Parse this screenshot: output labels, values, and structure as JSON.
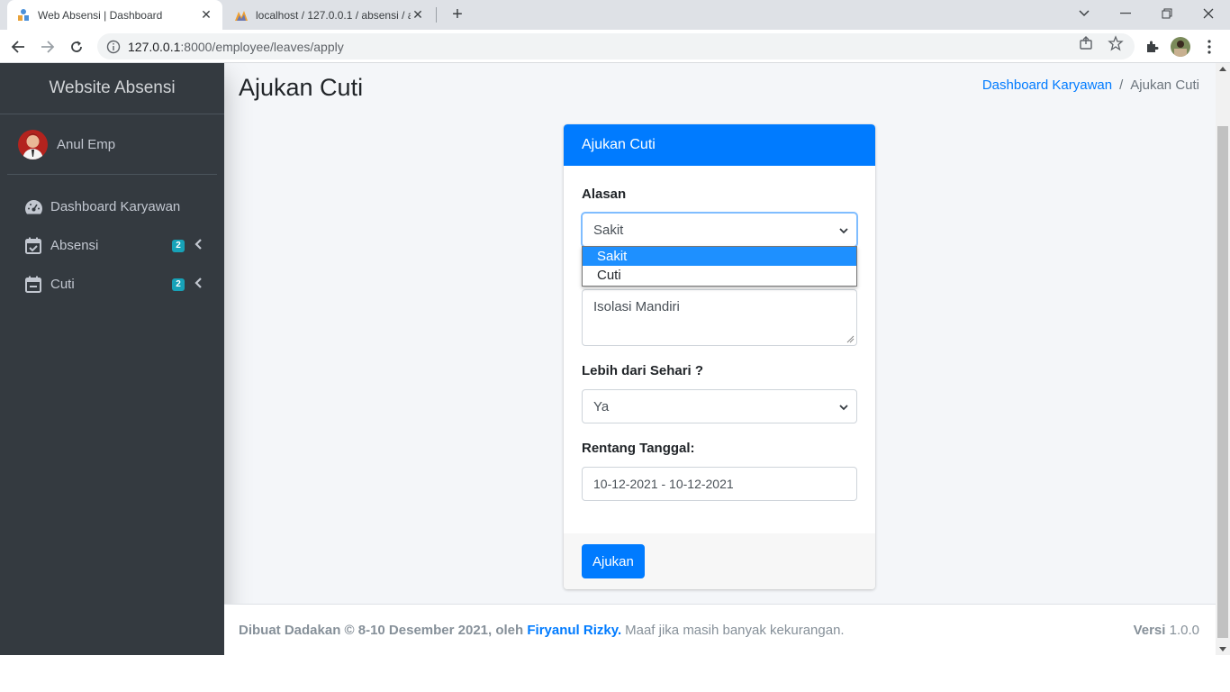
{
  "browser": {
    "tabs": [
      {
        "title": "Web Absensi | Dashboard",
        "active": true
      },
      {
        "title": "localhost / 127.0.0.1 / absensi / a",
        "active": false
      }
    ],
    "url_host": "127.0.0.1",
    "url_path": ":8000/employee/leaves/apply"
  },
  "sidebar": {
    "brand": "Website Absensi",
    "user": "Anul Emp",
    "items": [
      {
        "label": "Dashboard Karyawan",
        "icon": "tachometer-icon"
      },
      {
        "label": "Absensi",
        "icon": "calendar-check-icon",
        "badge": "2"
      },
      {
        "label": "Cuti",
        "icon": "calendar-minus-icon",
        "badge": "2"
      }
    ]
  },
  "header": {
    "title": "Ajukan Cuti",
    "breadcrumb": {
      "home": "Dashboard Karyawan",
      "separator": "/",
      "current": "Ajukan Cuti"
    }
  },
  "form": {
    "card_title": "Ajukan Cuti",
    "reason_label": "Alasan",
    "reason_value": "Sakit",
    "reason_options": [
      "Sakit",
      "Cuti"
    ],
    "description_value": "Isolasi Mandiri",
    "multi_day_label": "Lebih dari Sehari ?",
    "multi_day_value": "Ya",
    "range_label": "Rentang Tanggal:",
    "range_value": "10-12-2021 - 10-12-2021",
    "submit_label": "Ajukan"
  },
  "footer": {
    "prefix": "Dibuat Dadakan © 8-10 Desember 2021, oleh",
    "author": "Firyanul Rizky.",
    "message": "Maaf jika masih banyak kekurangan.",
    "version_label": "Versi",
    "version_value": "1.0.0"
  },
  "colors": {
    "primary": "#007bff",
    "sidebar": "#343a40",
    "badge": "#17a2b8"
  }
}
